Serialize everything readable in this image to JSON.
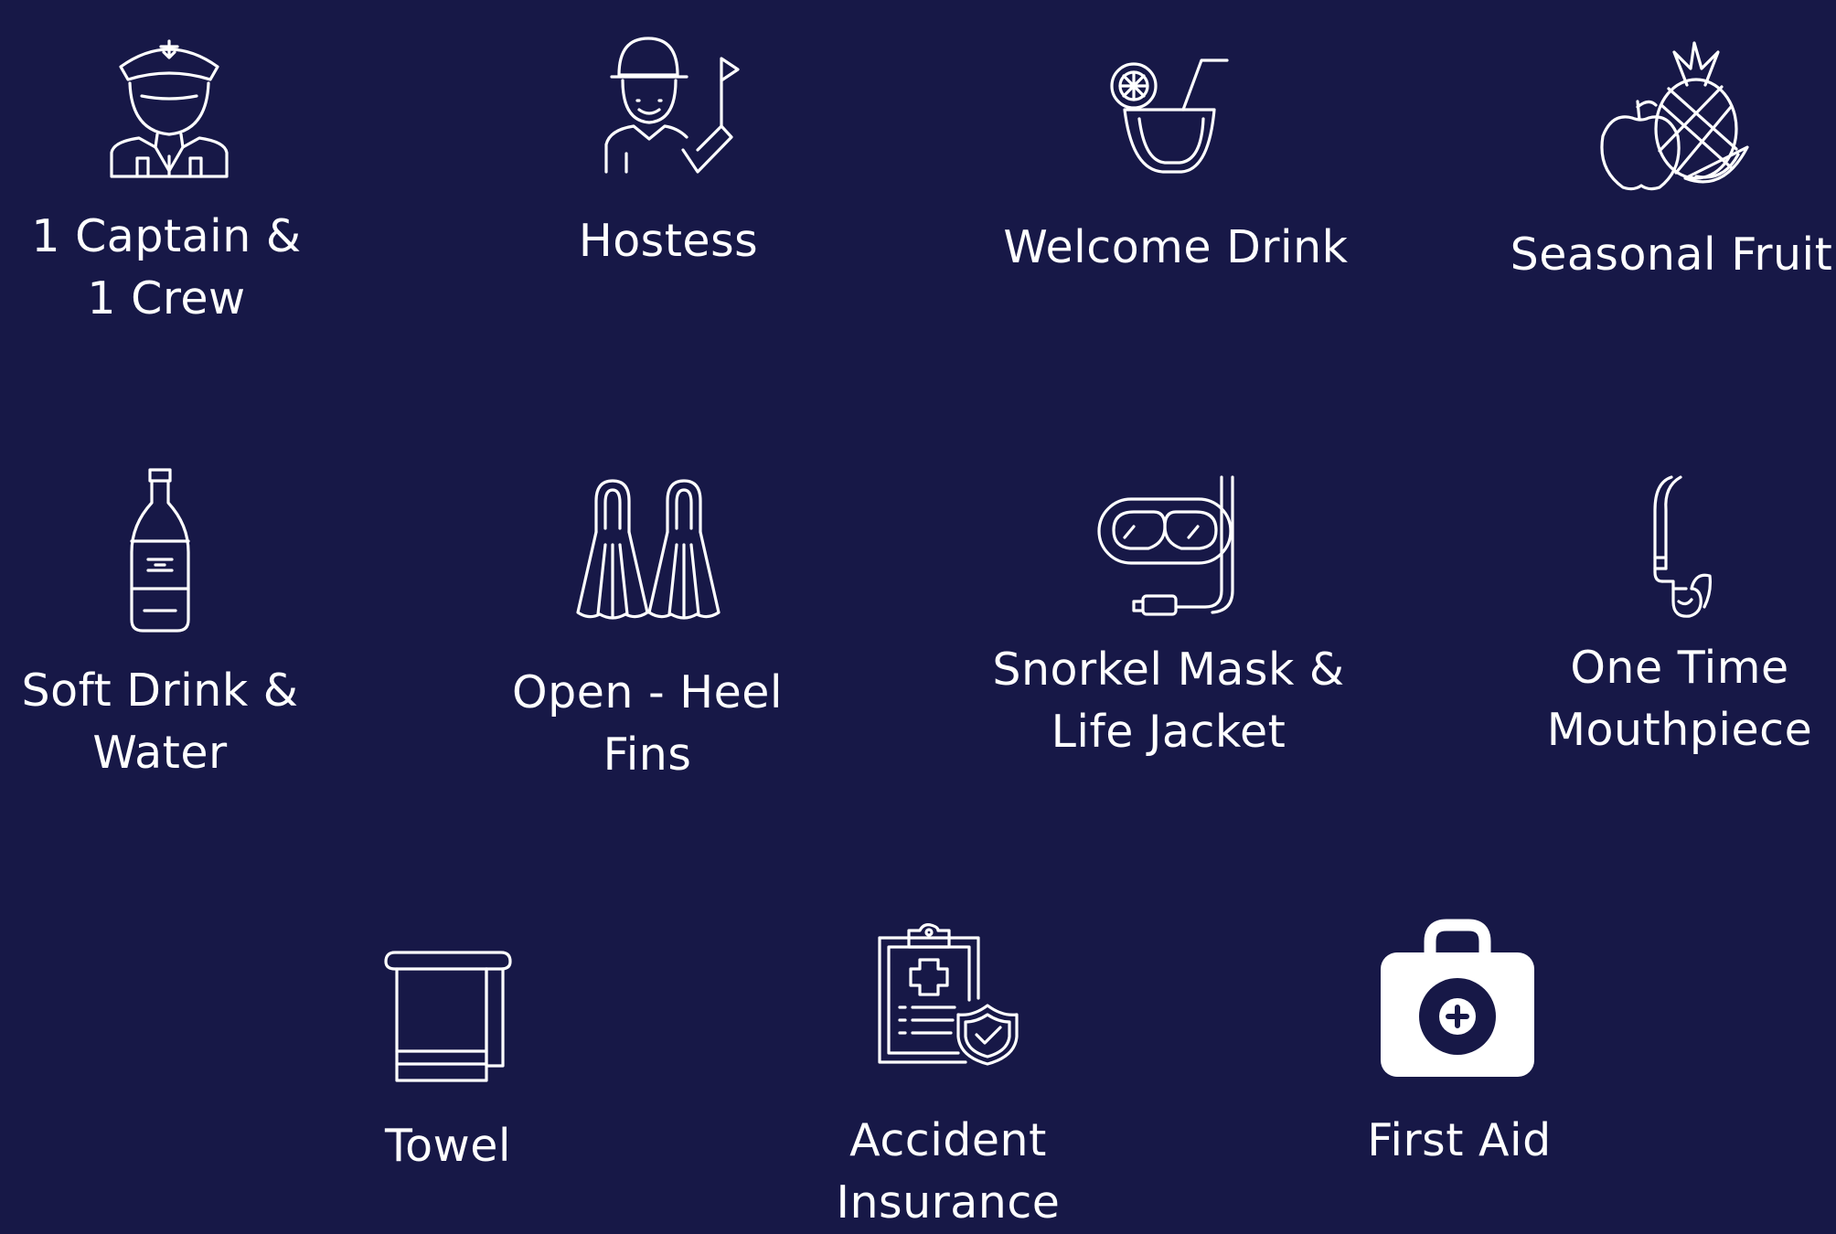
{
  "background_color": "#171847",
  "text_color": "#ffffff",
  "items": [
    {
      "icon": "captain-icon",
      "lines": [
        "1 Captain &",
        "1 Crew"
      ]
    },
    {
      "icon": "hostess-icon",
      "lines": [
        "Hostess"
      ]
    },
    {
      "icon": "welcome-drink-icon",
      "lines": [
        "Welcome Drink"
      ]
    },
    {
      "icon": "seasonal-fruit-icon",
      "lines": [
        "Seasonal Fruit"
      ]
    },
    {
      "icon": "soft-drink-bottle-icon",
      "lines": [
        "Soft Drink &",
        "Water"
      ]
    },
    {
      "icon": "fins-icon",
      "lines": [
        "Open - Heel",
        "Fins"
      ]
    },
    {
      "icon": "snorkel-mask-icon",
      "lines": [
        "Snorkel Mask &",
        "Life Jacket"
      ]
    },
    {
      "icon": "mouthpiece-icon",
      "lines": [
        "One Time",
        "Mouthpiece"
      ]
    },
    {
      "icon": "towel-icon",
      "lines": [
        "Towel"
      ]
    },
    {
      "icon": "accident-insurance-icon",
      "lines": [
        "Accident",
        "Insurance"
      ]
    },
    {
      "icon": "first-aid-kit-icon",
      "lines": [
        "First Aid"
      ]
    }
  ]
}
